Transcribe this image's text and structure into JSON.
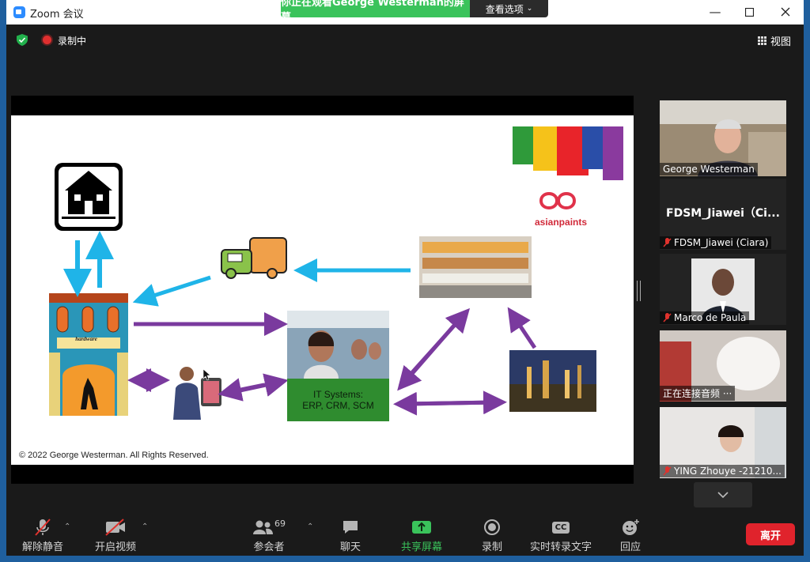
{
  "window": {
    "title": "Zoom 会议"
  },
  "share_banner": {
    "text": "你正在观看George  Westerman的屏幕",
    "options_label": "查看选项"
  },
  "recording": {
    "label": "录制中"
  },
  "view": {
    "label": "视图"
  },
  "slide": {
    "copyright": "© 2022 George Westerman. All Rights Reserved.",
    "logo_text": "asianpaints",
    "it_line1": "IT Systems:",
    "it_line2": "ERP, CRM, SCM",
    "store_sign": "hardware"
  },
  "participants": [
    {
      "name": "George Westerman",
      "active": true,
      "muted": false
    },
    {
      "name": "FDSM_Jiawei (Ciara)",
      "display": "FDSM_Jiawei（Ci...",
      "muted": true
    },
    {
      "name": "Marco de Paula",
      "muted": true
    },
    {
      "name": "正在连接音频 ···",
      "muted": false
    },
    {
      "name": "YING Zhouye  -21210...",
      "muted": true
    }
  ],
  "toolbar": {
    "unmute_label": "解除静音",
    "start_video_label": "开启视频",
    "participants_label": "参会者",
    "participants_count": "69",
    "chat_label": "聊天",
    "share_label": "共享屏幕",
    "record_label": "录制",
    "captions_label": "实时转录文字",
    "captions_icon_text": "CC",
    "reactions_label": "回应",
    "leave_label": "离开"
  },
  "colors": {
    "active_border": "#d6f062",
    "share_green": "#3ac35b",
    "leave_red": "#e0232c",
    "arrow_blue": "#1fb4e8",
    "arrow_purple": "#7a3a9e"
  }
}
